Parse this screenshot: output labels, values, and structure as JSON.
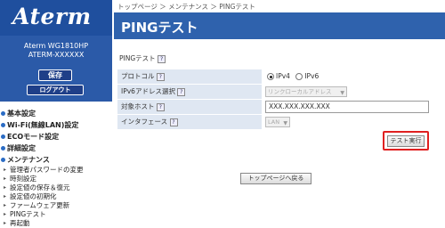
{
  "brand": {
    "logo": "Aterm"
  },
  "device": {
    "model": "Aterm WG1810HP",
    "ssid": "ATERM-XXXXXX"
  },
  "sidebar_buttons": {
    "save": "保存",
    "logout": "ログアウト"
  },
  "menu": [
    {
      "label": "基本設定"
    },
    {
      "label": "Wi-Fi(無線LAN)設定"
    },
    {
      "label": "ECOモード設定"
    },
    {
      "label": "詳細設定"
    },
    {
      "label": "メンテナンス"
    }
  ],
  "maintenance_items": [
    "管理者パスワードの変更",
    "時刻設定",
    "設定値の保存＆復元",
    "設定値の初期化",
    "ファームウェア更新",
    "PINGテスト",
    "再起動"
  ],
  "breadcrumb": "トップページ ＞ メンテナンス ＞ PINGテスト",
  "page_title": "PINGテスト",
  "section": {
    "title": "PINGテスト",
    "help": "?",
    "protocol": {
      "label": "プロトコル",
      "options": [
        "IPv4",
        "IPv6"
      ],
      "selected": "IPv4"
    },
    "ipv6_address": {
      "label": "IPv6アドレス選択",
      "value": "リンクローカルアドレス"
    },
    "target_host": {
      "label": "対象ホスト",
      "value": "XXX.XXX.XXX.XXX"
    },
    "interface": {
      "label": "インタフェース",
      "value": "LAN"
    }
  },
  "buttons": {
    "test_run": "テスト実行",
    "back_to_top": "トップページへ戻る"
  },
  "colors": {
    "header_blue": "#2f62ad",
    "highlight": "#e02020"
  }
}
